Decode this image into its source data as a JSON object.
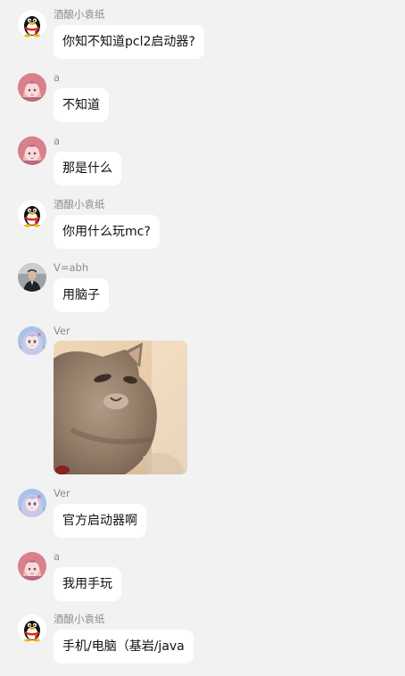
{
  "messages": [
    {
      "sender": "酒酿小袁纸",
      "avatar": "qq-penguin-avatar",
      "text": "你知不知道pcl2启动器?"
    },
    {
      "sender": "a",
      "avatar": "pink-hair-girl-avatar",
      "text": "不知道"
    },
    {
      "sender": "a",
      "avatar": "pink-hair-girl-avatar",
      "text": "那是什么"
    },
    {
      "sender": "酒酿小袁纸",
      "avatar": "qq-penguin-avatar",
      "text": "你用什么玩mc?"
    },
    {
      "sender": "V=abh",
      "avatar": "person-photo-avatar",
      "text": "用脑子"
    },
    {
      "sender": "Ver",
      "avatar": "anime-girl-avatar",
      "image": "cat-gif"
    },
    {
      "sender": "Ver",
      "avatar": "anime-girl-avatar",
      "text": "官方启动器啊"
    },
    {
      "sender": "a",
      "avatar": "pink-hair-girl-avatar",
      "text": "我用手玩"
    },
    {
      "sender": "酒酿小袁纸",
      "avatar": "qq-penguin-avatar",
      "text": "手机/电脑（基岩/java"
    }
  ],
  "colors": {
    "background": "#f2f2f2",
    "bubble": "#ffffff",
    "name": "#8c8c8c",
    "text": "#111111"
  }
}
